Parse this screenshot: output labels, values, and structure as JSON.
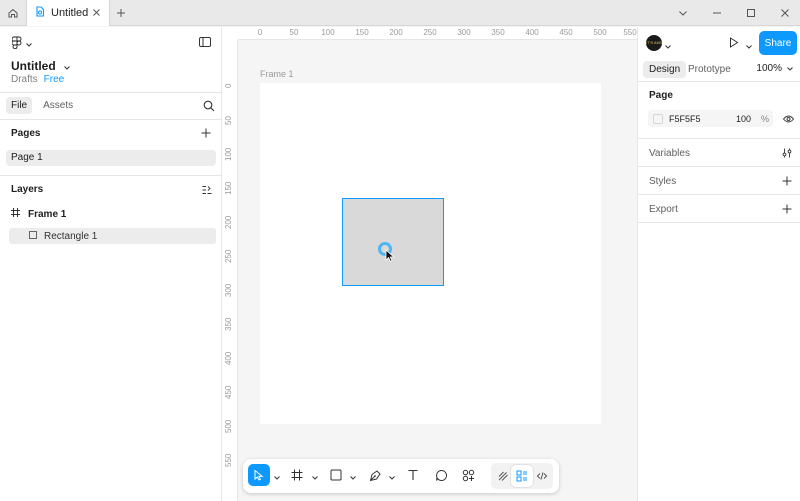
{
  "tabs": {
    "active_label": "Untitled"
  },
  "file": {
    "title": "Untitled",
    "location": "Drafts",
    "plan": "Free"
  },
  "left_tabs": {
    "file": "File",
    "assets": "Assets"
  },
  "pages": {
    "title": "Pages",
    "items": [
      "Page 1"
    ]
  },
  "layers": {
    "title": "Layers",
    "frame": "Frame 1",
    "rect": "Rectangle 1"
  },
  "canvas": {
    "frame_label": "Frame 1",
    "ruler_top": [
      "0",
      "50",
      "100",
      "150",
      "200",
      "250",
      "300",
      "350",
      "400",
      "450",
      "500",
      "550"
    ],
    "ruler_left": [
      "0",
      "50",
      "100",
      "150",
      "200",
      "250",
      "300",
      "350",
      "400",
      "450",
      "500",
      "550"
    ]
  },
  "right": {
    "share": "Share",
    "design_tab": "Design",
    "prototype_tab": "Prototype",
    "zoom": "100%",
    "page_section": "Page",
    "page_color": "F5F5F5",
    "page_opacity": "100",
    "page_opacity_unit": "%",
    "variables": "Variables",
    "styles": "Styles",
    "export": "Export",
    "avatar_text": "IT'S AKB"
  },
  "help": "?",
  "colors": {
    "accent": "#0d99ff",
    "selection": "#0d99ff",
    "rect_fill": "#d9d9d9"
  },
  "icons": [
    "home-icon",
    "figma-file-icon",
    "close-icon",
    "plus-icon",
    "minimize-icon",
    "maximize-icon",
    "window-close-icon",
    "figma-logo-icon",
    "panel-toggle-icon",
    "search-icon",
    "frame-icon",
    "rectangle-icon",
    "move-tool-icon",
    "frame-tool-icon",
    "rectangle-tool-icon",
    "pen-tool-icon",
    "text-tool-icon",
    "comment-tool-icon",
    "actions-icon",
    "draw-mode-icon",
    "design-mode-icon",
    "dev-mode-icon",
    "play-icon",
    "eye-icon",
    "variables-icon"
  ]
}
